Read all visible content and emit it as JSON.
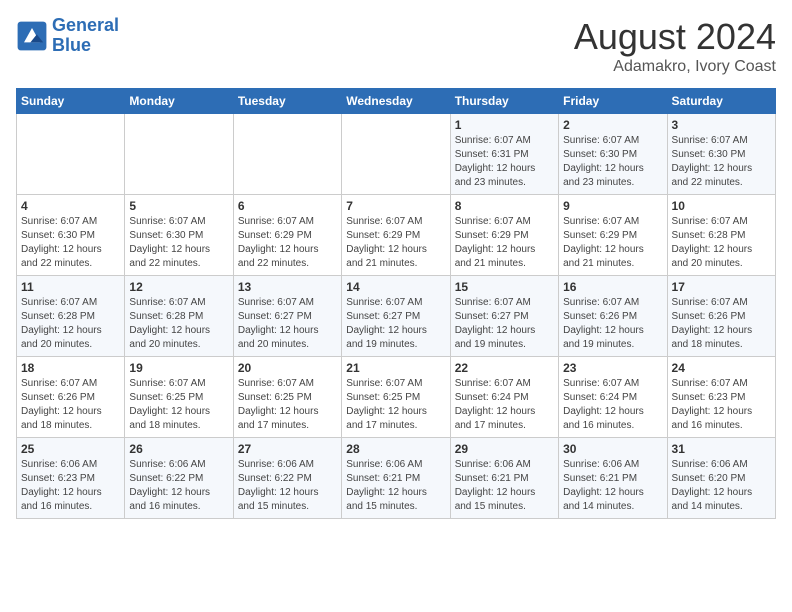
{
  "header": {
    "logo_line1": "General",
    "logo_line2": "Blue",
    "title": "August 2024",
    "subtitle": "Adamakro, Ivory Coast"
  },
  "calendar": {
    "days_of_week": [
      "Sunday",
      "Monday",
      "Tuesday",
      "Wednesday",
      "Thursday",
      "Friday",
      "Saturday"
    ],
    "weeks": [
      [
        {
          "day": "",
          "info": ""
        },
        {
          "day": "",
          "info": ""
        },
        {
          "day": "",
          "info": ""
        },
        {
          "day": "",
          "info": ""
        },
        {
          "day": "1",
          "info": "Sunrise: 6:07 AM\nSunset: 6:31 PM\nDaylight: 12 hours\nand 23 minutes."
        },
        {
          "day": "2",
          "info": "Sunrise: 6:07 AM\nSunset: 6:30 PM\nDaylight: 12 hours\nand 23 minutes."
        },
        {
          "day": "3",
          "info": "Sunrise: 6:07 AM\nSunset: 6:30 PM\nDaylight: 12 hours\nand 22 minutes."
        }
      ],
      [
        {
          "day": "4",
          "info": "Sunrise: 6:07 AM\nSunset: 6:30 PM\nDaylight: 12 hours\nand 22 minutes."
        },
        {
          "day": "5",
          "info": "Sunrise: 6:07 AM\nSunset: 6:30 PM\nDaylight: 12 hours\nand 22 minutes."
        },
        {
          "day": "6",
          "info": "Sunrise: 6:07 AM\nSunset: 6:29 PM\nDaylight: 12 hours\nand 22 minutes."
        },
        {
          "day": "7",
          "info": "Sunrise: 6:07 AM\nSunset: 6:29 PM\nDaylight: 12 hours\nand 21 minutes."
        },
        {
          "day": "8",
          "info": "Sunrise: 6:07 AM\nSunset: 6:29 PM\nDaylight: 12 hours\nand 21 minutes."
        },
        {
          "day": "9",
          "info": "Sunrise: 6:07 AM\nSunset: 6:29 PM\nDaylight: 12 hours\nand 21 minutes."
        },
        {
          "day": "10",
          "info": "Sunrise: 6:07 AM\nSunset: 6:28 PM\nDaylight: 12 hours\nand 20 minutes."
        }
      ],
      [
        {
          "day": "11",
          "info": "Sunrise: 6:07 AM\nSunset: 6:28 PM\nDaylight: 12 hours\nand 20 minutes."
        },
        {
          "day": "12",
          "info": "Sunrise: 6:07 AM\nSunset: 6:28 PM\nDaylight: 12 hours\nand 20 minutes."
        },
        {
          "day": "13",
          "info": "Sunrise: 6:07 AM\nSunset: 6:27 PM\nDaylight: 12 hours\nand 20 minutes."
        },
        {
          "day": "14",
          "info": "Sunrise: 6:07 AM\nSunset: 6:27 PM\nDaylight: 12 hours\nand 19 minutes."
        },
        {
          "day": "15",
          "info": "Sunrise: 6:07 AM\nSunset: 6:27 PM\nDaylight: 12 hours\nand 19 minutes."
        },
        {
          "day": "16",
          "info": "Sunrise: 6:07 AM\nSunset: 6:26 PM\nDaylight: 12 hours\nand 19 minutes."
        },
        {
          "day": "17",
          "info": "Sunrise: 6:07 AM\nSunset: 6:26 PM\nDaylight: 12 hours\nand 18 minutes."
        }
      ],
      [
        {
          "day": "18",
          "info": "Sunrise: 6:07 AM\nSunset: 6:26 PM\nDaylight: 12 hours\nand 18 minutes."
        },
        {
          "day": "19",
          "info": "Sunrise: 6:07 AM\nSunset: 6:25 PM\nDaylight: 12 hours\nand 18 minutes."
        },
        {
          "day": "20",
          "info": "Sunrise: 6:07 AM\nSunset: 6:25 PM\nDaylight: 12 hours\nand 17 minutes."
        },
        {
          "day": "21",
          "info": "Sunrise: 6:07 AM\nSunset: 6:25 PM\nDaylight: 12 hours\nand 17 minutes."
        },
        {
          "day": "22",
          "info": "Sunrise: 6:07 AM\nSunset: 6:24 PM\nDaylight: 12 hours\nand 17 minutes."
        },
        {
          "day": "23",
          "info": "Sunrise: 6:07 AM\nSunset: 6:24 PM\nDaylight: 12 hours\nand 16 minutes."
        },
        {
          "day": "24",
          "info": "Sunrise: 6:07 AM\nSunset: 6:23 PM\nDaylight: 12 hours\nand 16 minutes."
        }
      ],
      [
        {
          "day": "25",
          "info": "Sunrise: 6:06 AM\nSunset: 6:23 PM\nDaylight: 12 hours\nand 16 minutes."
        },
        {
          "day": "26",
          "info": "Sunrise: 6:06 AM\nSunset: 6:22 PM\nDaylight: 12 hours\nand 16 minutes."
        },
        {
          "day": "27",
          "info": "Sunrise: 6:06 AM\nSunset: 6:22 PM\nDaylight: 12 hours\nand 15 minutes."
        },
        {
          "day": "28",
          "info": "Sunrise: 6:06 AM\nSunset: 6:21 PM\nDaylight: 12 hours\nand 15 minutes."
        },
        {
          "day": "29",
          "info": "Sunrise: 6:06 AM\nSunset: 6:21 PM\nDaylight: 12 hours\nand 15 minutes."
        },
        {
          "day": "30",
          "info": "Sunrise: 6:06 AM\nSunset: 6:21 PM\nDaylight: 12 hours\nand 14 minutes."
        },
        {
          "day": "31",
          "info": "Sunrise: 6:06 AM\nSunset: 6:20 PM\nDaylight: 12 hours\nand 14 minutes."
        }
      ]
    ]
  }
}
